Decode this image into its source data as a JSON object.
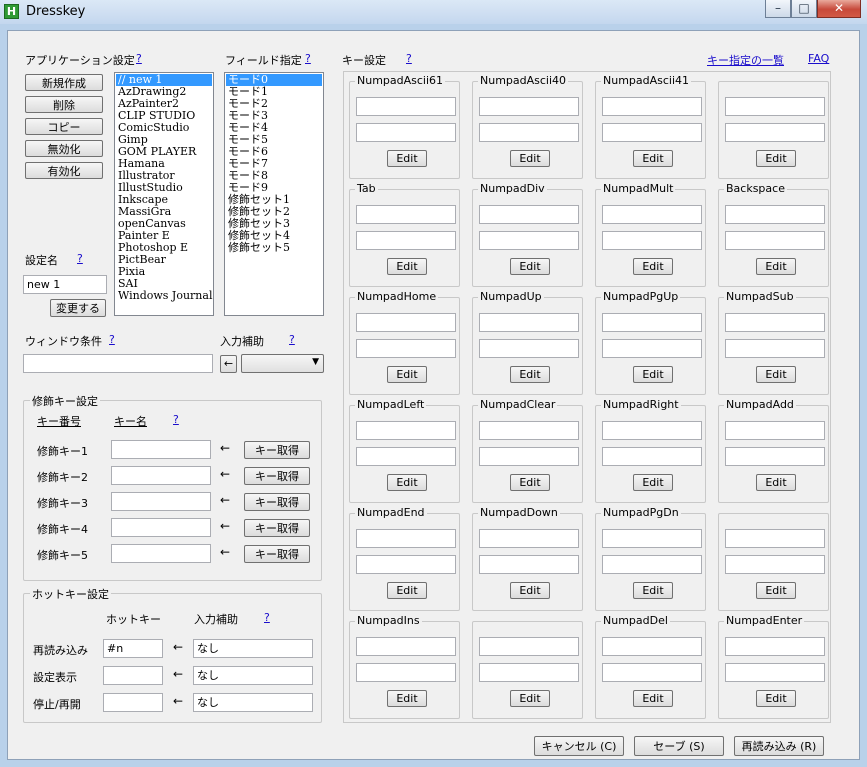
{
  "window": {
    "title": "Dresskey",
    "icon_letter": "H"
  },
  "left": {
    "app_settings_label": "アプリケーション設定",
    "help": "?",
    "buttons": {
      "new": "新規作成",
      "delete": "削除",
      "copy": "コピー",
      "disable": "無効化",
      "enable": "有効化"
    },
    "apps": [
      "// new 1",
      "AzDrawing2",
      "AzPainter2",
      "CLIP STUDIO",
      "ComicStudio",
      "Gimp",
      "GOM PLAYER",
      "Hamana",
      "Illustrator",
      "IllustStudio",
      "Inkscape",
      "MassiGra",
      "openCanvas",
      "Painter E",
      "Photoshop E",
      "PictBear",
      "Pixia",
      "SAI",
      "Windows Journal"
    ],
    "setting_name_label": "設定名",
    "setting_name_value": "new 1",
    "change_button": "変更する",
    "window_condition_label": "ウィンドウ条件",
    "window_condition_value": ""
  },
  "field": {
    "label": "フィールド指定",
    "items": [
      "モード0",
      "モード1",
      "モード2",
      "モード3",
      "モード4",
      "モード5",
      "モード6",
      "モード7",
      "モード8",
      "モード9",
      "修飾セット1",
      "修飾セット2",
      "修飾セット3",
      "修飾セット4",
      "修飾セット5"
    ],
    "input_assist_label": "入力補助",
    "assist_arrow": "←",
    "assist_value": ""
  },
  "modifier": {
    "group_title": "修飾キー設定",
    "col_number": "キー番号",
    "col_name": "キー名",
    "rows": [
      {
        "label": "修飾キー1",
        "value": "",
        "button": "キー取得"
      },
      {
        "label": "修飾キー2",
        "value": "",
        "button": "キー取得"
      },
      {
        "label": "修飾キー3",
        "value": "",
        "button": "キー取得"
      },
      {
        "label": "修飾キー4",
        "value": "",
        "button": "キー取得"
      },
      {
        "label": "修飾キー5",
        "value": "",
        "button": "キー取得"
      }
    ],
    "arrow": "←"
  },
  "hotkey": {
    "group_title": "ホットキー設定",
    "col_hotkey": "ホットキー",
    "col_assist": "入力補助",
    "rows": [
      {
        "label": "再読み込み",
        "hotkey": "#n",
        "assist": "なし"
      },
      {
        "label": "設定表示",
        "hotkey": "",
        "assist": "なし"
      },
      {
        "label": "停止/再開",
        "hotkey": "",
        "assist": "なし"
      }
    ],
    "arrow": "←"
  },
  "keys": {
    "label": "キー設定",
    "key_list_link": "キー指定の一覧",
    "faq_link": "FAQ",
    "edit_label": "Edit",
    "cells": [
      "NumpadAscii61",
      "NumpadAscii40",
      "NumpadAscii41",
      "",
      "Tab",
      "NumpadDiv",
      "NumpadMult",
      "Backspace",
      "NumpadHome",
      "NumpadUp",
      "NumpadPgUp",
      "NumpadSub",
      "NumpadLeft",
      "NumpadClear",
      "NumpadRight",
      "NumpadAdd",
      "NumpadEnd",
      "NumpadDown",
      "NumpadPgDn",
      "",
      "NumpadIns",
      "",
      "NumpadDel",
      "NumpadEnter"
    ]
  },
  "footer": {
    "cancel": "キャンセル (C)",
    "save": "セーブ (S)",
    "reload": "再読み込み (R)"
  }
}
